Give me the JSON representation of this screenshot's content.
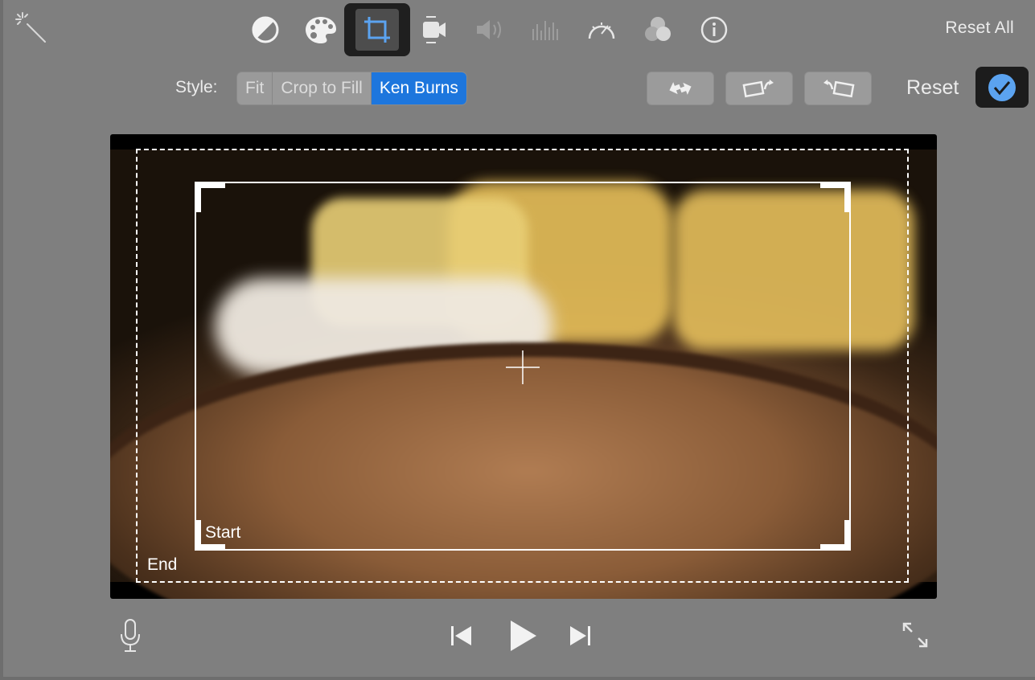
{
  "toolbar": {
    "tools": [
      {
        "icon": "magic-wand-icon"
      },
      {
        "icon": "color-balance-icon"
      },
      {
        "icon": "color-palette-icon"
      },
      {
        "icon": "crop-icon",
        "active": true
      },
      {
        "icon": "stabilization-icon"
      },
      {
        "icon": "volume-icon"
      },
      {
        "icon": "equalizer-icon"
      },
      {
        "icon": "speed-icon"
      },
      {
        "icon": "clip-filter-icon"
      },
      {
        "icon": "info-icon"
      }
    ],
    "reset_all_label": "Reset All"
  },
  "crop_bar": {
    "style_label": "Style:",
    "options": [
      "Fit",
      "Crop to Fill",
      "Ken Burns"
    ],
    "selected": "Ken Burns",
    "reset_label": "Reset",
    "buttons": [
      "swap-start-end-icon",
      "rotate-left-icon",
      "rotate-right-icon",
      "apply-checkmark-icon"
    ]
  },
  "viewer": {
    "start_label": "Start",
    "end_label": "End"
  },
  "playback": {
    "controls": [
      "microphone-icon",
      "skip-back-icon",
      "play-icon",
      "skip-forward-icon",
      "fullscreen-icon"
    ]
  },
  "colors": {
    "background": "#7f7f7f",
    "accent": "#1d76dd",
    "active_tool_icon": "#5ba3f0"
  }
}
